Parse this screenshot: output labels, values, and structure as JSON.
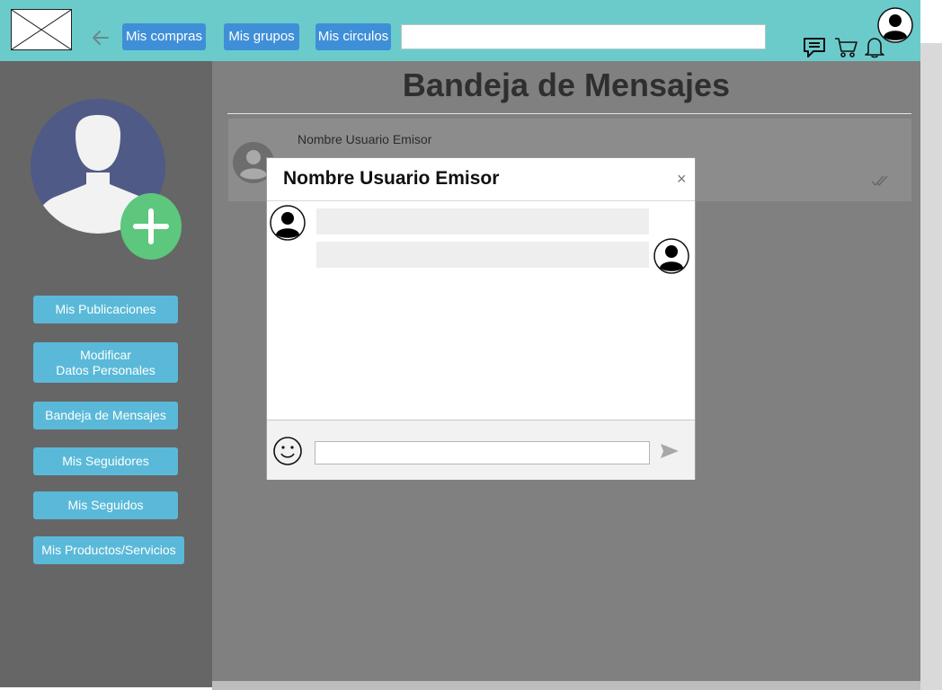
{
  "header": {
    "nav": [
      "Mis compras",
      "Mis grupos",
      "Mis circulos"
    ],
    "search_placeholder": ""
  },
  "sidebar": {
    "items": [
      "Mis Publicaciones",
      "Modificar\nDatos Personales",
      "Bandeja de Mensajes",
      "Mis Seguidores",
      "Mis Seguidos",
      "Mis Productos/Servicios"
    ]
  },
  "main": {
    "title": "Bandeja de Mensajes",
    "messages": [
      {
        "sender": "Nombre Usuario Emisor"
      }
    ]
  },
  "modal": {
    "title": "Nombre Usuario Emisor",
    "close": "×",
    "input_placeholder": ""
  },
  "icons": {
    "logo": "image-placeholder-icon",
    "back": "arrow-left-icon",
    "chat": "chat-bubble-icon",
    "cart": "cart-icon",
    "bell": "bell-icon",
    "profile": "user-silhouette-icon",
    "add": "plus-circle-icon",
    "read": "double-check-icon",
    "emoji": "smiley-icon",
    "send": "send-icon"
  },
  "colors": {
    "header": "#6bcbcb",
    "nav_button": "#3f8fd8",
    "side_button": "#5ab9d8",
    "sidebar": "#666666",
    "overlay": "#808080",
    "add_button": "#5cc77d",
    "profile_bg": "#505a87"
  }
}
